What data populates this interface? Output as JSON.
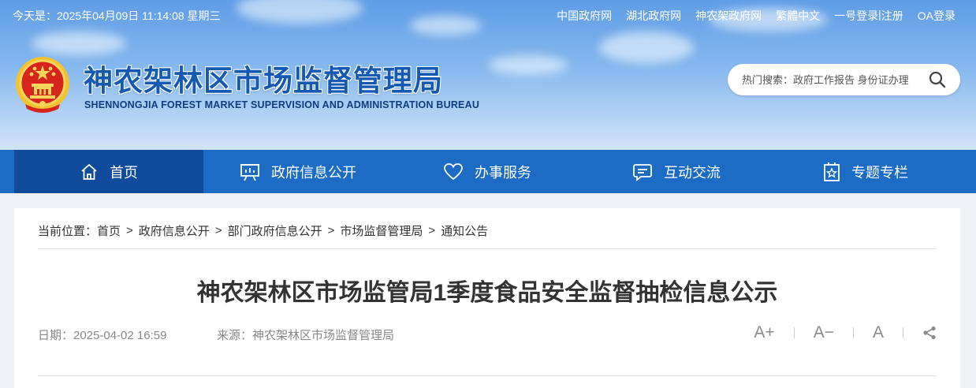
{
  "topbar": {
    "date_text": "今天是：2025年04月09日 11:14:08 星期三",
    "links": [
      "中国政府网",
      "湖北政府网",
      "神农架政府网",
      "繁體中文",
      "一号登录",
      "注册",
      "OA登录"
    ],
    "login_sep": "|"
  },
  "header": {
    "title": "神农架林区市场监督管理局",
    "subtitle": "SHENNONGJIA FOREST MARKET SUPERVISION AND ADMINISTRATION BUREAU",
    "search_placeholder": "热门搜索：政府工作报告 身份证办理"
  },
  "nav": {
    "items": [
      {
        "label": "首页",
        "icon": "home-icon"
      },
      {
        "label": "政府信息公开",
        "icon": "presentation-board-icon"
      },
      {
        "label": "办事服务",
        "icon": "heart-icon"
      },
      {
        "label": "互动交流",
        "icon": "chat-icon"
      },
      {
        "label": "专题专栏",
        "icon": "badge-star-icon"
      }
    ]
  },
  "breadcrumb": {
    "prefix": "当前位置：",
    "items": [
      "首页",
      "政府信息公开",
      "部门政府信息公开",
      "市场监督管理局",
      "通知公告"
    ],
    "separator": ">"
  },
  "article": {
    "title": "神农架林区市场监管局1季度食品安全监督抽检信息公示",
    "date": "日期：2025-04-02 16:59",
    "source": "来源：神农架林区市场监督管理局"
  },
  "tools": {
    "font_larger": "A+",
    "font_smaller": "A−",
    "font_default": "A"
  },
  "colors": {
    "nav_bg": "#1c6bc5",
    "nav_active": "#104b9c",
    "title_blue": "#1659b2"
  }
}
